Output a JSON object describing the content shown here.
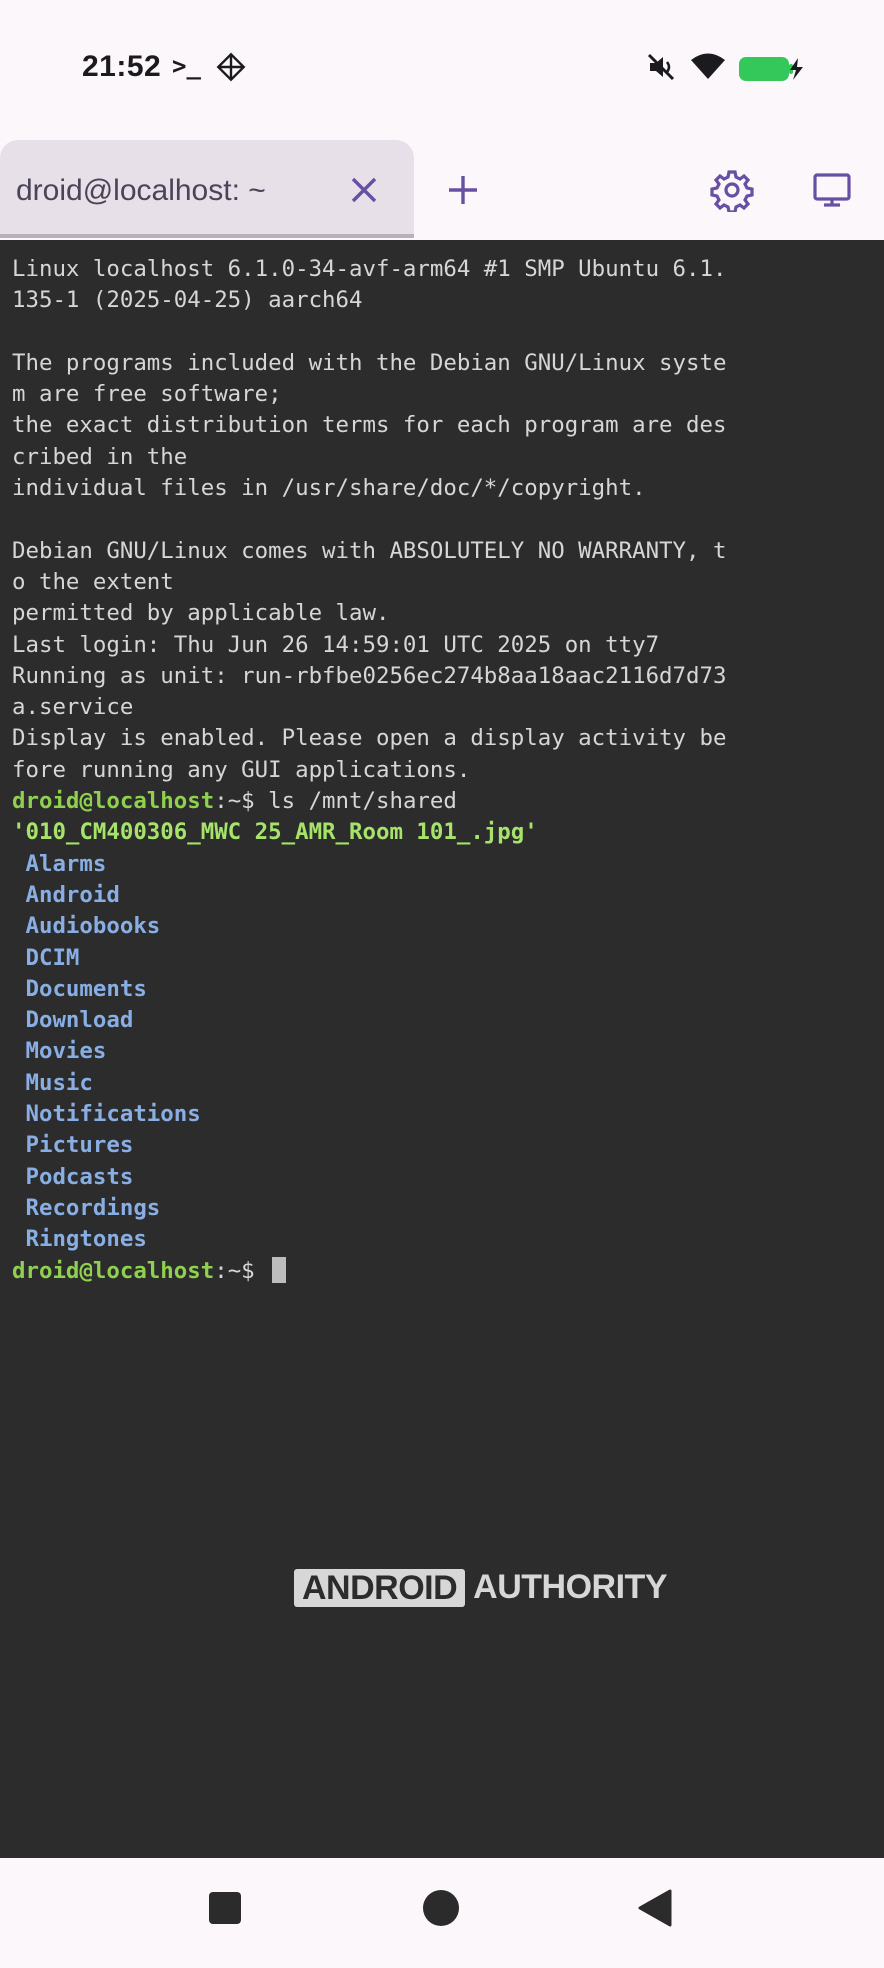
{
  "status_bar": {
    "time": "21:52",
    "terminal_indicator": ">_",
    "icons": [
      "diamond-app-icon",
      "mute-icon",
      "wifi-icon",
      "battery-charging-icon"
    ]
  },
  "tabs": [
    {
      "label": "droid@localhost: ~",
      "active": true
    }
  ],
  "toolbar": {
    "close_icon": "close-icon",
    "add_icon": "plus-icon",
    "settings_icon": "gear-icon",
    "display_icon": "monitor-icon"
  },
  "terminal": {
    "lines": [
      "Linux localhost 6.1.0-34-avf-arm64 #1 SMP Ubuntu 6.1.",
      "135-1 (2025-04-25) aarch64",
      "",
      "The programs included with the Debian GNU/Linux syste",
      "m are free software;",
      "the exact distribution terms for each program are des",
      "cribed in the",
      "individual files in /usr/share/doc/*/copyright.",
      "",
      "Debian GNU/Linux comes with ABSOLUTELY NO WARRANTY, t",
      "o the extent",
      "permitted by applicable law.",
      "Last login: Thu Jun 26 14:59:01 UTC 2025 on tty7",
      "Running as unit: run-rbfbe0256ec274b8aa18aac2116d7d73",
      "a.service",
      "Display is enabled. Please open a display activity be",
      "fore running any GUI applications."
    ],
    "prompt": "droid@localhost",
    "prompt_suffix": ":~$ ",
    "command": "ls /mnt/shared",
    "file_entry": "'010_CM400306_MWC 25_AMR_Room 101_.jpg'",
    "directories": [
      "Alarms",
      "Android",
      "Audiobooks",
      "DCIM",
      "Documents",
      "Download",
      "Movies",
      "Music",
      "Notifications",
      "Pictures",
      "Podcasts",
      "Recordings",
      "Ringtones"
    ],
    "final_prompt": "droid@localhost",
    "final_prompt_suffix": ":~$ "
  },
  "watermark": {
    "part1": "ANDROID",
    "part2": "AUTHORITY"
  },
  "colors": {
    "terminal_bg": "#2c2c2c",
    "text": "#d6d6d6",
    "prompt": "#8fd14f",
    "directory": "#88aee4",
    "accent": "#6750a4"
  }
}
